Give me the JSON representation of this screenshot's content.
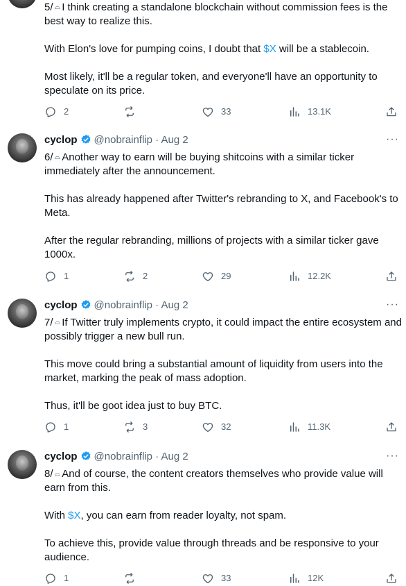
{
  "tweets": [
    {
      "show_header": false,
      "name": "",
      "handle": "",
      "date": "",
      "paragraphs": [
        [
          "5/",
          "I think creating a standalone blockchain without commission fees is the best way to realize this."
        ],
        [
          "With Elon's love for pumping coins, I doubt that ",
          "$X",
          " will be a stablecoin."
        ],
        [
          "Most likely, it'll be a regular token, and everyone'll have an opportunity to speculate on its price."
        ]
      ],
      "replies": "2",
      "retweets": "",
      "likes": "33",
      "views": "13.1K"
    },
    {
      "show_header": true,
      "name": "cyclop",
      "handle": "@nobrainflip",
      "date": "· Aug 2",
      "more": "···",
      "paragraphs": [
        [
          "6/",
          "Another way to earn will be buying shitcoins with a similar ticker immediately after the announcement."
        ],
        [
          "This has already happened after Twitter's rebranding to X, and Facebook's to Meta."
        ],
        [
          " After the regular rebranding, millions of projects with a similar ticker gave 1000x."
        ]
      ],
      "replies": "1",
      "retweets": "2",
      "likes": "29",
      "views": "12.2K"
    },
    {
      "show_header": true,
      "name": "cyclop",
      "handle": "@nobrainflip",
      "date": "· Aug 2",
      "more": "···",
      "paragraphs": [
        [
          "7/",
          "If Twitter truly implements crypto, it could impact the entire ecosystem and possibly trigger a new bull run."
        ],
        [
          "This move could bring a substantial amount of liquidity from users into the market, marking the peak of mass adoption."
        ],
        [
          "Thus, it'll be goot idea just to buy BTC."
        ]
      ],
      "replies": "1",
      "retweets": "3",
      "likes": "32",
      "views": "11.3K"
    },
    {
      "show_header": true,
      "name": "cyclop",
      "handle": "@nobrainflip",
      "date": "· Aug 2",
      "more": "···",
      "paragraphs": [
        [
          "8/",
          "And of course, the content creators themselves who provide value will earn from this."
        ],
        [
          "With ",
          "$X",
          ", you can earn from reader loyalty, not spam."
        ],
        [
          "To achieve this, provide value through threads and be responsive to your audience."
        ]
      ],
      "replies": "1",
      "retweets": "",
      "likes": "33",
      "views": "12K"
    }
  ],
  "colors": {
    "link": "#1d9bf0",
    "muted": "#536471",
    "text": "#0f1419",
    "verified": "#1d9bf0"
  }
}
